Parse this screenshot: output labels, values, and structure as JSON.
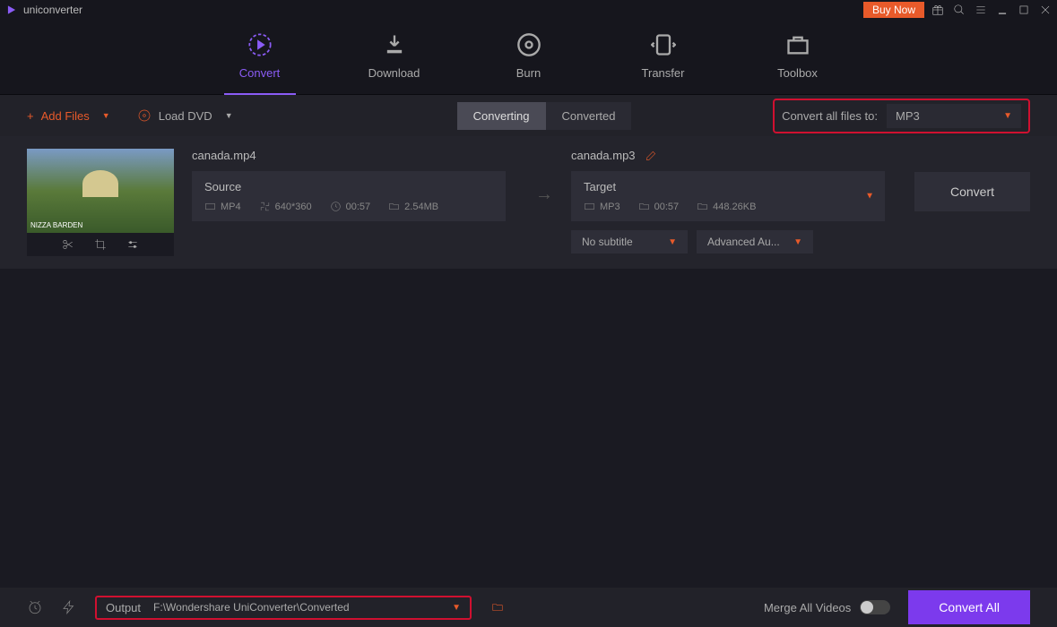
{
  "app": {
    "title": "uniconverter",
    "buy_now": "Buy Now"
  },
  "nav": {
    "convert": "Convert",
    "download": "Download",
    "burn": "Burn",
    "transfer": "Transfer",
    "toolbox": "Toolbox"
  },
  "toolbar": {
    "add_files": "Add Files",
    "load_dvd": "Load DVD",
    "converting": "Converting",
    "converted": "Converted",
    "convert_all_label": "Convert all files to:",
    "format": "MP3"
  },
  "file": {
    "source_name": "canada.mp4",
    "target_name": "canada.mp3",
    "source": {
      "title": "Source",
      "format": "MP4",
      "resolution": "640*360",
      "duration": "00:57",
      "size": "2.54MB"
    },
    "target": {
      "title": "Target",
      "format": "MP3",
      "duration": "00:57",
      "size": "448.26KB"
    },
    "subtitle": "No subtitle",
    "audio": "Advanced Au...",
    "convert_btn": "Convert"
  },
  "bottom": {
    "output_label": "Output",
    "output_path": "F:\\Wondershare UniConverter\\Converted",
    "merge_label": "Merge All Videos",
    "convert_all_btn": "Convert All"
  }
}
